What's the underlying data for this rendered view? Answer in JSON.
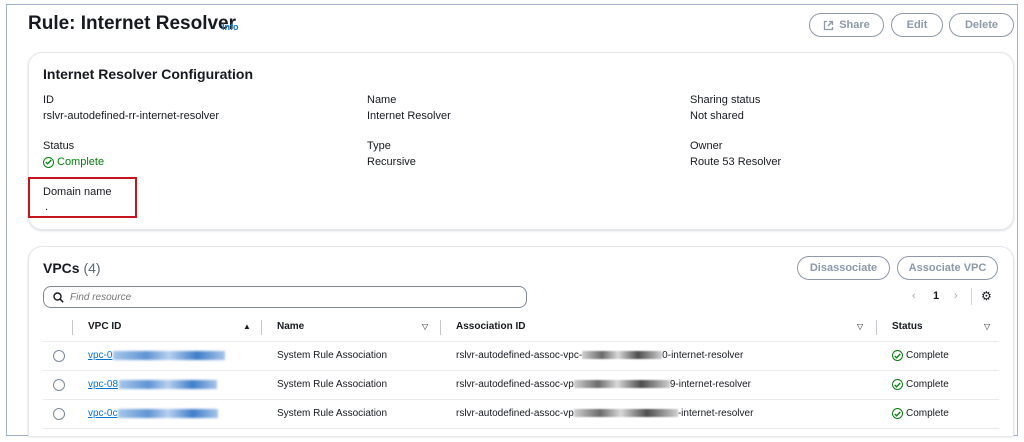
{
  "header": {
    "title": "Rule: Internet Resolver",
    "info_label": "Info",
    "share_label": "Share",
    "edit_label": "Edit",
    "delete_label": "Delete"
  },
  "config": {
    "title": "Internet Resolver Configuration",
    "id_label": "ID",
    "id_value": "rslvr-autodefined-rr-internet-resolver",
    "name_label": "Name",
    "name_value": "Internet Resolver",
    "sharing_label": "Sharing status",
    "sharing_value": "Not shared",
    "status_label": "Status",
    "status_value": "Complete",
    "type_label": "Type",
    "type_value": "Recursive",
    "owner_label": "Owner",
    "owner_value": "Route 53 Resolver",
    "domain_label": "Domain name",
    "domain_value": "."
  },
  "vpcs": {
    "title": "VPCs",
    "count": "(4)",
    "disassociate_label": "Disassociate",
    "associate_label": "Associate VPC",
    "search_placeholder": "Find resource",
    "page": "1",
    "columns": {
      "vpc_id": "VPC ID",
      "name": "Name",
      "association_id": "Association ID",
      "status": "Status"
    },
    "rows": [
      {
        "vpc_prefix": "vpc-0",
        "name": "System Rule Association",
        "assoc_prefix": "rslvr-autodefined-assoc-vpc-",
        "assoc_suffix": "0-internet-resolver",
        "status": "Complete"
      },
      {
        "vpc_prefix": "vpc-08",
        "name": "System Rule Association",
        "assoc_prefix": "rslvr-autodefined-assoc-vp",
        "assoc_suffix": "9-internet-resolver",
        "status": "Complete"
      },
      {
        "vpc_prefix": "vpc-0c",
        "name": "System Rule Association",
        "assoc_prefix": "rslvr-autodefined-assoc-vp",
        "assoc_suffix": "-internet-resolver",
        "status": "Complete"
      }
    ]
  },
  "colors": {
    "link": "#0972d3",
    "success": "#037f0c",
    "highlight": "#c4161c"
  },
  "icons": [
    "external-link-icon",
    "check-circle-icon",
    "search-icon",
    "sort-up-icon",
    "sort-down-icon",
    "chevron-left-icon",
    "chevron-right-icon",
    "gear-icon"
  ]
}
